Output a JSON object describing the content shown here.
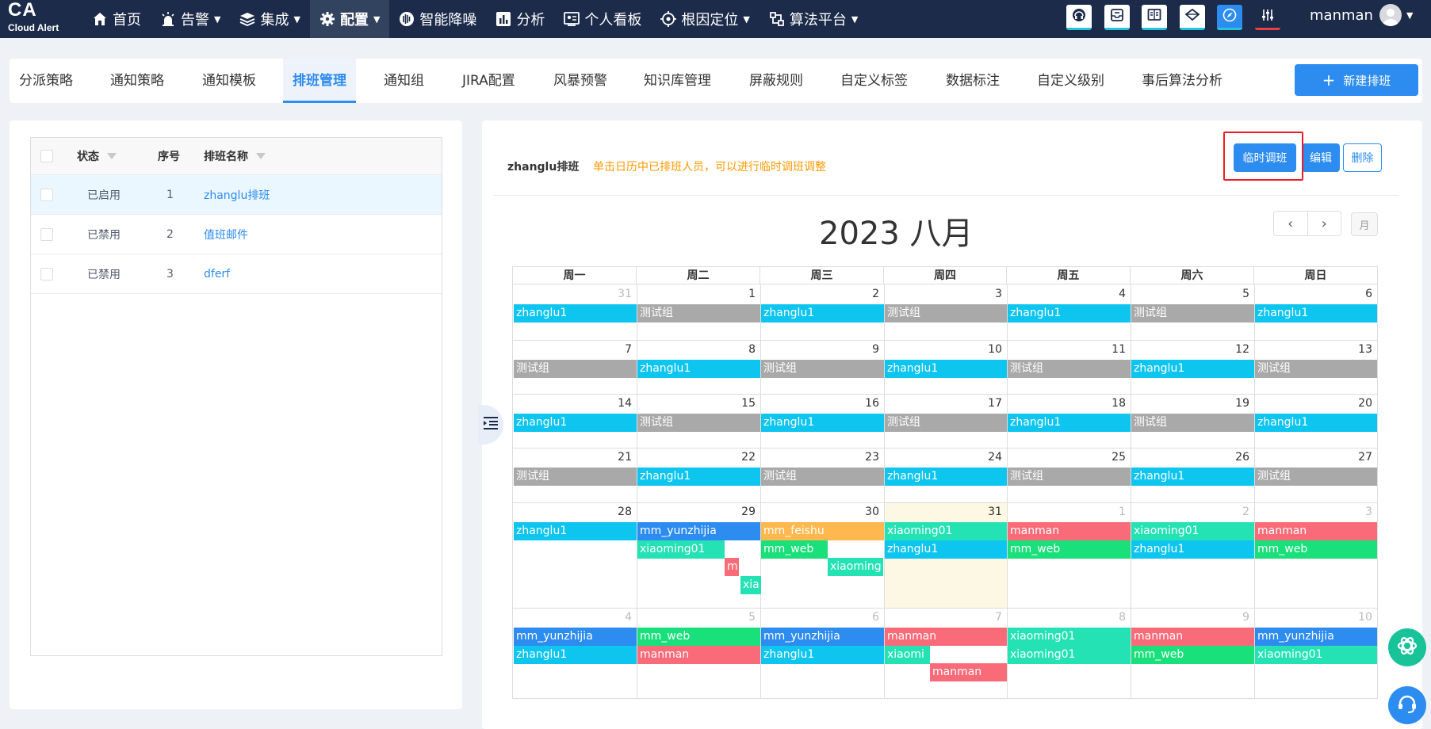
{
  "brand": {
    "line1": "CA",
    "line2": "Cloud Alert"
  },
  "nav": [
    {
      "label": "首页",
      "icon": "home-icon",
      "caret": false
    },
    {
      "label": "告警",
      "icon": "alarm-icon",
      "caret": true
    },
    {
      "label": "集成",
      "icon": "layers-icon",
      "caret": true
    },
    {
      "label": "配置",
      "icon": "gear-icon",
      "caret": true,
      "active": true
    },
    {
      "label": "智能降噪",
      "icon": "noise-reduction-icon",
      "caret": false
    },
    {
      "label": "分析",
      "icon": "bar-chart-icon",
      "caret": false
    },
    {
      "label": "个人看板",
      "icon": "dashboard-icon",
      "caret": false
    },
    {
      "label": "根因定位",
      "icon": "target-icon",
      "caret": true
    },
    {
      "label": "算法平台",
      "icon": "algorithm-icon",
      "caret": true
    }
  ],
  "tools": [
    "headset-icon",
    "inbox-icon",
    "book-icon",
    "diamond-icon",
    "compass-icon",
    "sliders-icon"
  ],
  "user": {
    "name": "manman"
  },
  "tabs": [
    "分派策略",
    "通知策略",
    "通知模板",
    "排班管理",
    "通知组",
    "JIRA配置",
    "风暴预警",
    "知识库管理",
    "屏蔽规则",
    "自定义标签",
    "数据标注",
    "自定义级别",
    "事后算法分析"
  ],
  "active_tab": "排班管理",
  "new_button": {
    "plus": "+",
    "label": "新建排班"
  },
  "table": {
    "headers": {
      "status": "状态",
      "index": "序号",
      "name": "排班名称"
    },
    "rows": [
      {
        "status": "已启用",
        "index": "1",
        "name": "zhanglu排班"
      },
      {
        "status": "已禁用",
        "index": "2",
        "name": "值班邮件"
      },
      {
        "status": "已禁用",
        "index": "3",
        "name": "dferf"
      }
    ]
  },
  "schedule": {
    "name": "zhanglu排班",
    "hint": "单击日历中已排班人员，可以进行临时调班调整",
    "buttons": {
      "temp_swap": "临时调班",
      "edit": "编辑",
      "delete": "删除"
    }
  },
  "calendar": {
    "title": "2023 八月",
    "view_button": "月",
    "prev": "‹",
    "next": "›",
    "weekdays": [
      "周一",
      "周二",
      "周三",
      "周四",
      "周五",
      "周六",
      "周日"
    ],
    "weeks": [
      {
        "days": [
          {
            "n": "31",
            "other": true,
            "events": [
              {
                "name": "zhanglu1",
                "color": "cyan"
              }
            ]
          },
          {
            "n": "1",
            "events": [
              {
                "name": "测试组",
                "color": "gray"
              }
            ]
          },
          {
            "n": "2",
            "events": [
              {
                "name": "zhanglu1",
                "color": "cyan"
              }
            ]
          },
          {
            "n": "3",
            "events": [
              {
                "name": "测试组",
                "color": "gray"
              }
            ]
          },
          {
            "n": "4",
            "events": [
              {
                "name": "zhanglu1",
                "color": "cyan"
              }
            ]
          },
          {
            "n": "5",
            "events": [
              {
                "name": "测试组",
                "color": "gray"
              }
            ]
          },
          {
            "n": "6",
            "events": [
              {
                "name": "zhanglu1",
                "color": "cyan"
              }
            ]
          }
        ]
      },
      {
        "days": [
          {
            "n": "7",
            "events": [
              {
                "name": "测试组",
                "color": "gray"
              }
            ]
          },
          {
            "n": "8",
            "events": [
              {
                "name": "zhanglu1",
                "color": "cyan"
              }
            ]
          },
          {
            "n": "9",
            "events": [
              {
                "name": "测试组",
                "color": "gray"
              }
            ]
          },
          {
            "n": "10",
            "events": [
              {
                "name": "zhanglu1",
                "color": "cyan"
              }
            ]
          },
          {
            "n": "11",
            "events": [
              {
                "name": "测试组",
                "color": "gray"
              }
            ]
          },
          {
            "n": "12",
            "events": [
              {
                "name": "zhanglu1",
                "color": "cyan"
              }
            ]
          },
          {
            "n": "13",
            "events": [
              {
                "name": "测试组",
                "color": "gray"
              }
            ]
          }
        ]
      },
      {
        "days": [
          {
            "n": "14",
            "events": [
              {
                "name": "zhanglu1",
                "color": "cyan"
              }
            ]
          },
          {
            "n": "15",
            "events": [
              {
                "name": "测试组",
                "color": "gray"
              }
            ]
          },
          {
            "n": "16",
            "events": [
              {
                "name": "zhanglu1",
                "color": "cyan"
              }
            ]
          },
          {
            "n": "17",
            "events": [
              {
                "name": "测试组",
                "color": "gray"
              }
            ]
          },
          {
            "n": "18",
            "events": [
              {
                "name": "zhanglu1",
                "color": "cyan"
              }
            ]
          },
          {
            "n": "19",
            "events": [
              {
                "name": "测试组",
                "color": "gray"
              }
            ]
          },
          {
            "n": "20",
            "events": [
              {
                "name": "zhanglu1",
                "color": "cyan"
              }
            ]
          }
        ]
      },
      {
        "days": [
          {
            "n": "21",
            "events": [
              {
                "name": "测试组",
                "color": "gray"
              }
            ]
          },
          {
            "n": "22",
            "events": [
              {
                "name": "zhanglu1",
                "color": "cyan"
              }
            ]
          },
          {
            "n": "23",
            "events": [
              {
                "name": "测试组",
                "color": "gray"
              }
            ]
          },
          {
            "n": "24",
            "events": [
              {
                "name": "zhanglu1",
                "color": "cyan"
              }
            ]
          },
          {
            "n": "25",
            "events": [
              {
                "name": "测试组",
                "color": "gray"
              }
            ]
          },
          {
            "n": "26",
            "events": [
              {
                "name": "zhanglu1",
                "color": "cyan"
              }
            ]
          },
          {
            "n": "27",
            "events": [
              {
                "name": "测试组",
                "color": "gray"
              }
            ]
          }
        ]
      },
      {
        "days": [
          {
            "n": "28",
            "events": [
              {
                "name": "zhanglu1",
                "color": "cyan"
              }
            ]
          },
          {
            "n": "29",
            "events": [
              {
                "name": "mm_yunzhijia",
                "color": "blue"
              },
              {
                "name": "xiaoming01",
                "color": "teal"
              },
              {
                "name": "m",
                "color": "red"
              },
              {
                "name": "xia",
                "color": "teal"
              }
            ]
          },
          {
            "n": "30",
            "events": [
              {
                "name": "mm_feishu",
                "color": "orange"
              },
              {
                "name": "mm_web",
                "color": "green"
              },
              {
                "name": "xiaoming",
                "color": "teal"
              }
            ]
          },
          {
            "n": "31",
            "today": true,
            "events": [
              {
                "name": "xiaoming01",
                "color": "teal"
              },
              {
                "name": "zhanglu1",
                "color": "cyan"
              }
            ]
          },
          {
            "n": "1",
            "other": true,
            "events": [
              {
                "name": "manman",
                "color": "red"
              },
              {
                "name": "mm_web",
                "color": "green"
              }
            ]
          },
          {
            "n": "2",
            "other": true,
            "events": [
              {
                "name": "xiaoming01",
                "color": "teal"
              },
              {
                "name": "zhanglu1",
                "color": "cyan"
              }
            ]
          },
          {
            "n": "3",
            "other": true,
            "events": [
              {
                "name": "manman",
                "color": "red"
              },
              {
                "name": "mm_web",
                "color": "green"
              }
            ]
          }
        ]
      },
      {
        "days": [
          {
            "n": "4",
            "other": true,
            "events": [
              {
                "name": "mm_yunzhijia",
                "color": "blue"
              },
              {
                "name": "zhanglu1",
                "color": "cyan"
              }
            ]
          },
          {
            "n": "5",
            "other": true,
            "events": [
              {
                "name": "mm_web",
                "color": "green"
              },
              {
                "name": "manman",
                "color": "red"
              }
            ]
          },
          {
            "n": "6",
            "other": true,
            "events": [
              {
                "name": "mm_yunzhijia",
                "color": "blue"
              },
              {
                "name": "zhanglu1",
                "color": "cyan"
              }
            ]
          },
          {
            "n": "7",
            "other": true,
            "events": [
              {
                "name": "manman",
                "color": "red"
              },
              {
                "name": "xiaomi",
                "color": "teal"
              },
              {
                "name": "manman",
                "color": "red"
              }
            ]
          },
          {
            "n": "8",
            "other": true,
            "events": [
              {
                "name": "xiaoming01",
                "color": "teal"
              },
              {
                "name": "xiaoming01",
                "color": "teal"
              }
            ]
          },
          {
            "n": "9",
            "other": true,
            "events": [
              {
                "name": "manman",
                "color": "red"
              },
              {
                "name": "mm_web",
                "color": "green"
              }
            ]
          },
          {
            "n": "10",
            "other": true,
            "events": [
              {
                "name": "mm_yunzhijia",
                "color": "blue"
              },
              {
                "name": "xiaoming01",
                "color": "teal"
              }
            ]
          }
        ]
      }
    ]
  },
  "colors": {
    "topbar": "#1c2b4a",
    "accent": "#2d8cf0",
    "hint": "#ff9900",
    "cyan": "#0ec5f0",
    "gray": "#a9a9a9",
    "blue": "#2d8cf0",
    "orange": "#ffb84d",
    "green": "#19e07b",
    "red": "#f96b78",
    "teal": "#25e2b5"
  },
  "floating_buttons": [
    "chat-assistant-icon",
    "customer-service-icon"
  ]
}
